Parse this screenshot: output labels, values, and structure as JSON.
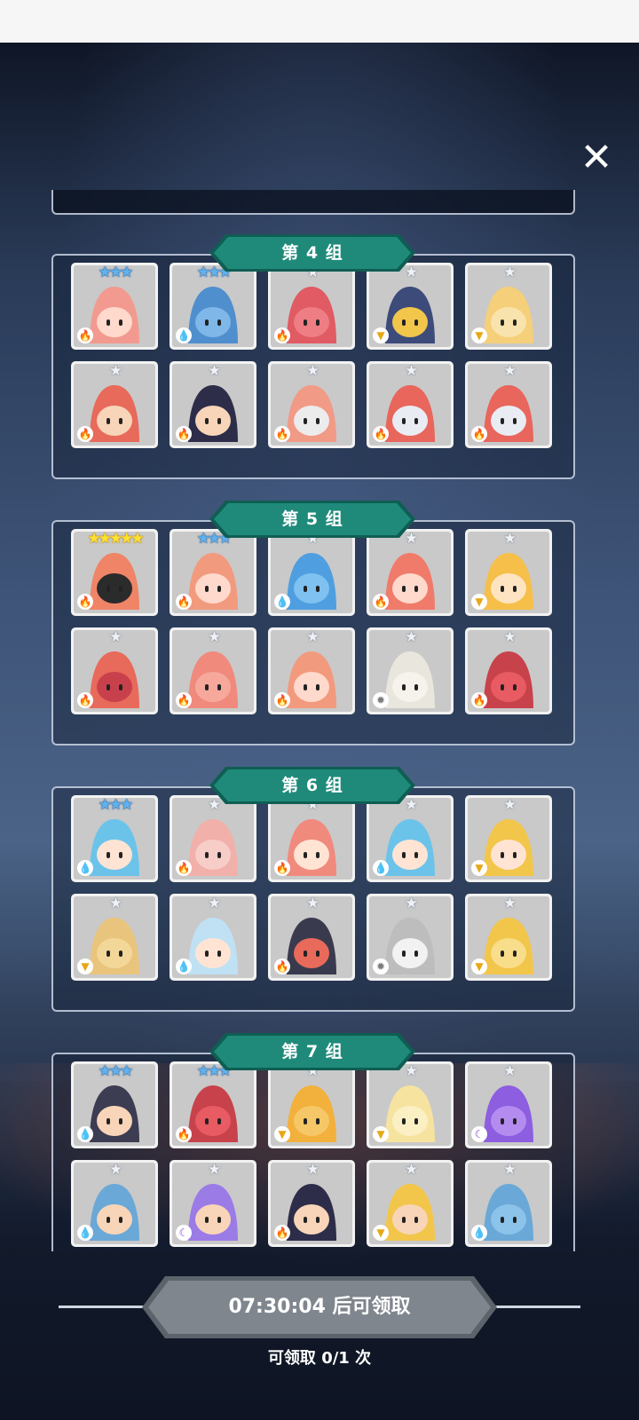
{
  "close_icon": "close-x",
  "groups": [
    {
      "title": "第 4 组",
      "heroes": [
        {
          "stars": "★★★",
          "star_color": "blue",
          "element": "fire",
          "bg": "#f29a8f",
          "face": "#ffd9cc"
        },
        {
          "stars": "★★★",
          "star_color": "blue",
          "element": "water",
          "bg": "#4f8fce",
          "face": "#7fb7e8"
        },
        {
          "stars": "★",
          "star_color": "silver",
          "element": "fire",
          "bg": "#e05b63",
          "face": "#ef7d84"
        },
        {
          "stars": "★",
          "star_color": "silver",
          "element": "earth",
          "bg": "#3d4b7a",
          "face": "#f2c64b"
        },
        {
          "stars": "★",
          "star_color": "silver",
          "element": "earth",
          "bg": "#f5cf7a",
          "face": "#f9e3ad"
        },
        {
          "stars": "★",
          "star_color": "silver",
          "element": "fire",
          "bg": "#e86a5a",
          "face": "#f8d5b8"
        },
        {
          "stars": "★",
          "star_color": "silver",
          "element": "fire",
          "bg": "#2d2d4a",
          "face": "#f8d5b8"
        },
        {
          "stars": "★",
          "star_color": "silver",
          "element": "fire",
          "bg": "#f19a86",
          "face": "#ececec"
        },
        {
          "stars": "★",
          "star_color": "silver",
          "element": "fire",
          "bg": "#e8665c",
          "face": "#e9ecf3"
        },
        {
          "stars": "★",
          "star_color": "silver",
          "element": "fire",
          "bg": "#e8665c",
          "face": "#e9ecf3"
        }
      ]
    },
    {
      "title": "第 5 组",
      "heroes": [
        {
          "stars": "★★★★★",
          "star_color": "gold",
          "element": "fire",
          "bg": "#f08467",
          "face": "#2b2b2b"
        },
        {
          "stars": "★★★",
          "star_color": "blue",
          "element": "fire",
          "bg": "#f29a7e",
          "face": "#ffd9cc"
        },
        {
          "stars": "★",
          "star_color": "silver",
          "element": "water",
          "bg": "#4f9fe0",
          "face": "#7fc1f0"
        },
        {
          "stars": "★",
          "star_color": "silver",
          "element": "fire",
          "bg": "#f07b6b",
          "face": "#ffd9cc"
        },
        {
          "stars": "★",
          "star_color": "silver",
          "element": "earth",
          "bg": "#f6bf4a",
          "face": "#ffe4c2"
        },
        {
          "stars": "★",
          "star_color": "silver",
          "element": "fire",
          "bg": "#e86a5a",
          "face": "#c9404d"
        },
        {
          "stars": "★",
          "star_color": "silver",
          "element": "fire",
          "bg": "#f08a7d",
          "face": "#f6a99b"
        },
        {
          "stars": "★",
          "star_color": "silver",
          "element": "fire",
          "bg": "#f29a7e",
          "face": "#ffd9cc"
        },
        {
          "stars": "★",
          "star_color": "silver",
          "element": "light",
          "bg": "#e9e6de",
          "face": "#f6f3ec"
        },
        {
          "stars": "★",
          "star_color": "silver",
          "element": "fire",
          "bg": "#c8424b",
          "face": "#e85b63"
        }
      ]
    },
    {
      "title": "第 6 组",
      "heroes": [
        {
          "stars": "★★★",
          "star_color": "blue",
          "element": "water",
          "bg": "#6cc3ea",
          "face": "#ffe4d4"
        },
        {
          "stars": "★",
          "star_color": "silver",
          "element": "fire",
          "bg": "#f2b0aa",
          "face": "#f7cdc8"
        },
        {
          "stars": "★",
          "star_color": "silver",
          "element": "fire",
          "bg": "#f08a7d",
          "face": "#ffe4d4"
        },
        {
          "stars": "★",
          "star_color": "silver",
          "element": "water",
          "bg": "#6cc3ea",
          "face": "#ffe4d4"
        },
        {
          "stars": "★",
          "star_color": "silver",
          "element": "earth",
          "bg": "#f2c64b",
          "face": "#ffe4d4"
        },
        {
          "stars": "★",
          "star_color": "silver",
          "element": "earth",
          "bg": "#e9c47c",
          "face": "#f3d799"
        },
        {
          "stars": "★",
          "star_color": "silver",
          "element": "water",
          "bg": "#bfe1f3",
          "face": "#ffe4d4"
        },
        {
          "stars": "★",
          "star_color": "silver",
          "element": "fire",
          "bg": "#3a3a4e",
          "face": "#e86a5a"
        },
        {
          "stars": "★",
          "star_color": "silver",
          "element": "light",
          "bg": "#bdbdbd",
          "face": "#f2f2f2"
        },
        {
          "stars": "★",
          "star_color": "silver",
          "element": "earth",
          "bg": "#f2c64b",
          "face": "#f8dd8a"
        }
      ]
    },
    {
      "title": "第 7 组",
      "heroes": [
        {
          "stars": "★★★",
          "star_color": "blue",
          "element": "water",
          "bg": "#3c3c52",
          "face": "#f8d5b8"
        },
        {
          "stars": "★★★",
          "star_color": "blue",
          "element": "fire",
          "bg": "#c8424b",
          "face": "#e85b63"
        },
        {
          "stars": "★",
          "star_color": "silver",
          "element": "earth",
          "bg": "#f2b13c",
          "face": "#f6c766"
        },
        {
          "stars": "★",
          "star_color": "silver",
          "element": "earth",
          "bg": "#f6e3a0",
          "face": "#fbf0c4"
        },
        {
          "stars": "★",
          "star_color": "silver",
          "element": "dark",
          "bg": "#8d5ee0",
          "face": "#b48cf0"
        },
        {
          "stars": "★",
          "star_color": "silver",
          "element": "water",
          "bg": "#6aa8d8",
          "face": "#f8d5b8"
        },
        {
          "stars": "★",
          "star_color": "silver",
          "element": "dark",
          "bg": "#9b7be6",
          "face": "#f8d5b8"
        },
        {
          "stars": "★",
          "star_color": "silver",
          "element": "fire",
          "bg": "#2d2d4a",
          "face": "#f8d5b8"
        },
        {
          "stars": "★",
          "star_color": "silver",
          "element": "earth",
          "bg": "#f2c64b",
          "face": "#f8d5b8"
        },
        {
          "stars": "★",
          "star_color": "silver",
          "element": "water",
          "bg": "#6aa8d8",
          "face": "#8cc3ea"
        }
      ]
    }
  ],
  "claim": {
    "button_label": "07:30:04 后可领取",
    "count_text": "可领取 0/1 次"
  },
  "colors": {
    "banner_teal": "#1f8a7a",
    "banner_dark": "#0f5e53",
    "button_gray": "#7f858d"
  }
}
